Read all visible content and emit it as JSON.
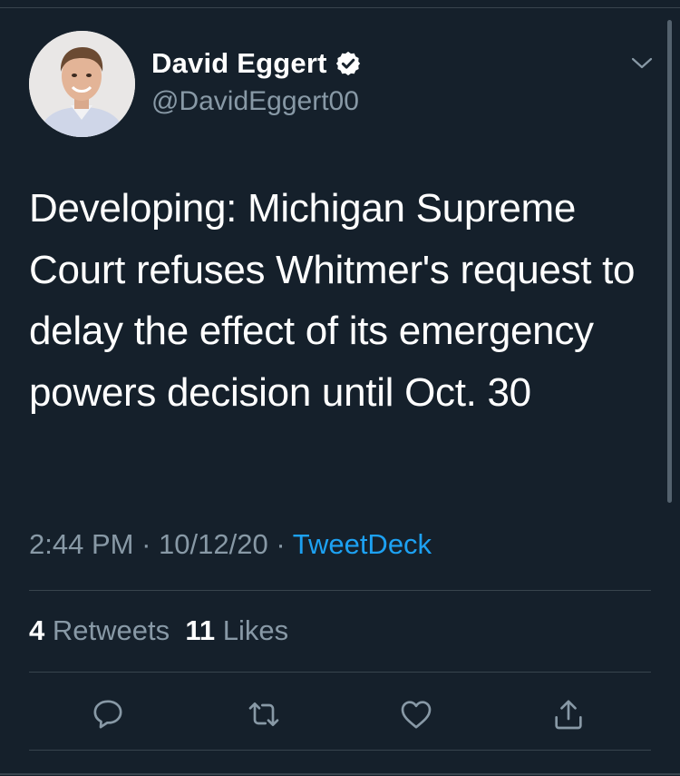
{
  "tweet": {
    "author": {
      "display_name": "David Eggert",
      "handle": "@DavidEggert00",
      "verified": true,
      "avatar_icon": "profile-photo"
    },
    "text": "Developing: Michigan Supreme Court refuses Whitmer's request to delay the effect of its emergency powers decision until Oct. 30",
    "time": "2:44 PM",
    "date": "10/12/20",
    "source": "TweetDeck",
    "separator": "·",
    "stats": {
      "retweets_count": "4",
      "retweets_label": "Retweets",
      "likes_count": "11",
      "likes_label": "Likes"
    },
    "actions": [
      {
        "name": "reply",
        "icon": "reply-icon"
      },
      {
        "name": "retweet",
        "icon": "retweet-icon"
      },
      {
        "name": "like",
        "icon": "heart-icon"
      },
      {
        "name": "share",
        "icon": "share-icon"
      }
    ]
  },
  "colors": {
    "background": "#15202b",
    "text_primary": "#ffffff",
    "text_secondary": "#8899a6",
    "accent": "#1da1f2",
    "divider": "#38444d"
  }
}
